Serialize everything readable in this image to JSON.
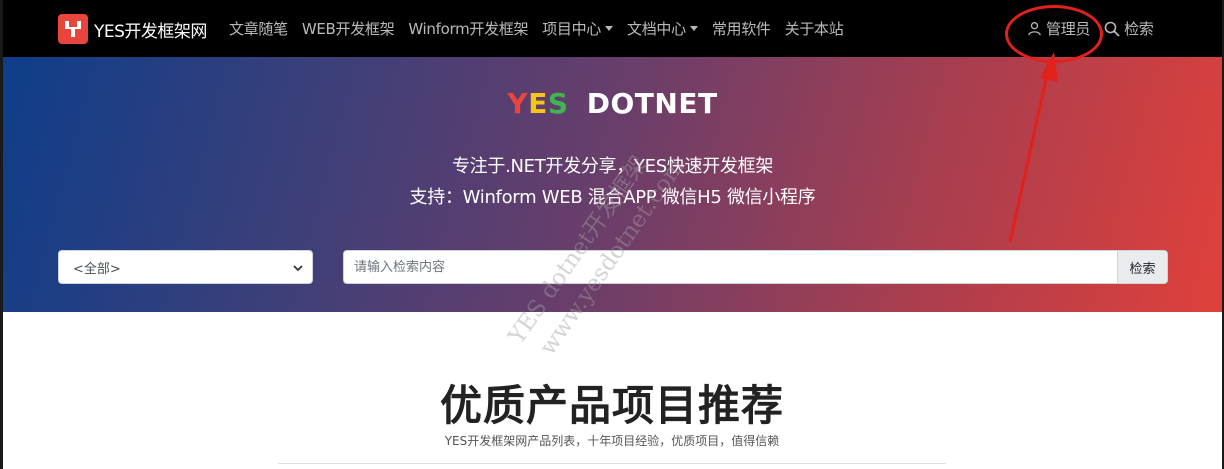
{
  "navbar": {
    "brand_name": "YES开发框架网",
    "links": [
      {
        "label": "文章随笔",
        "dropdown": false
      },
      {
        "label": "WEB开发框架",
        "dropdown": false
      },
      {
        "label": "Winform开发框架",
        "dropdown": false
      },
      {
        "label": "项目中心",
        "dropdown": true
      },
      {
        "label": "文档中心",
        "dropdown": true
      },
      {
        "label": "常用软件",
        "dropdown": false
      },
      {
        "label": "关于本站",
        "dropdown": false
      }
    ],
    "admin_label": "管理员",
    "search_label": "检索"
  },
  "hero": {
    "title_yes": [
      "Y",
      "E",
      "S"
    ],
    "title_rest": "DOTNET",
    "subtitle_1": "专注于.NET开发分享，YES快速开发框架",
    "subtitle_2": "支持：Winform WEB 混合APP 微信H5 微信小程序",
    "select_value": "<全部>",
    "search_placeholder": "请输入检索内容",
    "search_button": "检索"
  },
  "watermark": {
    "line_1": "YES  dotnet开发框架",
    "line_2": "www.yesdotnet.com"
  },
  "content": {
    "title": "优质产品项目推荐",
    "subtitle": "YES开发框架网产品列表，十年项目经验，优质项目，值得信赖"
  },
  "colors": {
    "navbar_bg": "#000000",
    "brand_red": "#e8453c",
    "title_y": "#e8453c",
    "title_e": "#f5c518",
    "title_s": "#3fb450",
    "annotation_red": "#e2211c"
  }
}
